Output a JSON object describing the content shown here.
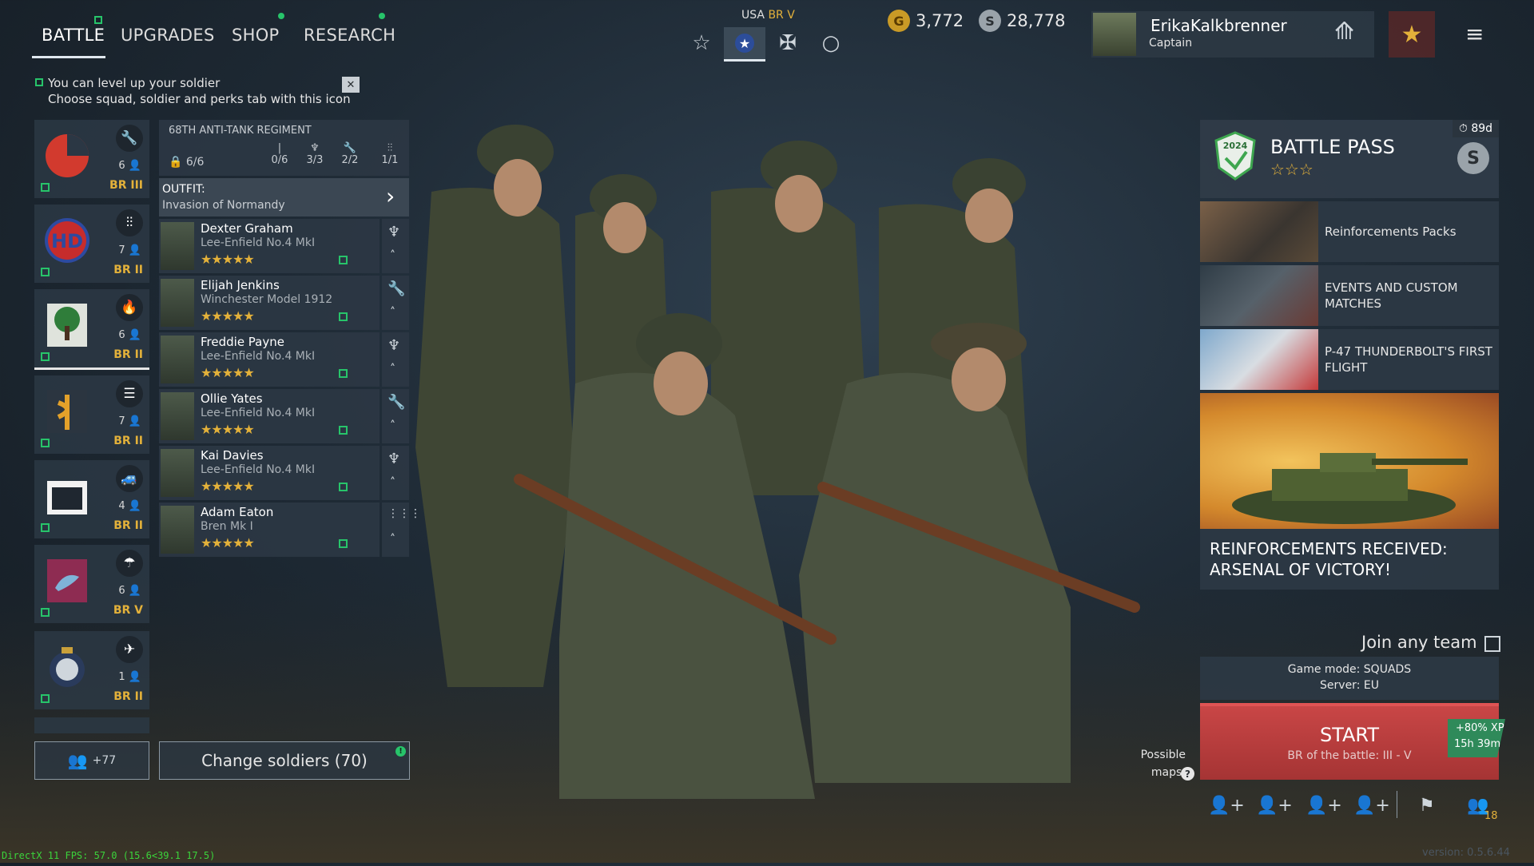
{
  "nav": {
    "tabs": [
      "BATTLE",
      "UPGRADES",
      "SHOP",
      "RESEARCH"
    ]
  },
  "army": {
    "nation": "USA",
    "br": "BR V",
    "selectors": [
      "star-outline-icon",
      "star-badge-icon",
      "cross-icon",
      "circle-icon"
    ]
  },
  "currency": {
    "gold_symbol": "G",
    "gold": "3,772",
    "silver_symbol": "S",
    "silver": "28,778"
  },
  "player": {
    "name": "ErikaKalkbrenner",
    "rank": "Captain"
  },
  "hint": {
    "line1": "You can level up your soldier",
    "line2": "Choose squad, soldier and perks tab with this icon",
    "close": "✕"
  },
  "squads": [
    {
      "icon": "wrench-icon",
      "glyph": "🔧",
      "count": "6",
      "br": "BR III"
    },
    {
      "icon": "rifles-icon",
      "glyph": "⋮⋮",
      "count": "7",
      "br": "BR II"
    },
    {
      "icon": "flame-icon",
      "glyph": "🔥",
      "count": "6",
      "br": "BR II"
    },
    {
      "icon": "list-icon",
      "glyph": "☰",
      "count": "7",
      "br": "BR II"
    },
    {
      "icon": "vehicle-icon",
      "glyph": "🚙",
      "count": "4",
      "br": "BR II"
    },
    {
      "icon": "parachute-icon",
      "glyph": "☂",
      "count": "6",
      "br": "BR V"
    },
    {
      "icon": "planes-icon",
      "glyph": "✈",
      "count": "1",
      "br": "BR II"
    }
  ],
  "regiment": {
    "name": "68TH ANTI-TANK REGIMENT",
    "slots": "6/6",
    "stats": [
      "0/6",
      "3/3",
      "2/2",
      "1/1"
    ],
    "outfit_label": "OUTFIT:",
    "outfit_value": "Invasion of Normandy",
    "soldiers": [
      {
        "name": "Dexter Graham",
        "weapon": "Lee-Enfield No.4 MkI",
        "stars": "★★★★★",
        "class_glyph": "♆"
      },
      {
        "name": "Elijah Jenkins",
        "weapon": "Winchester Model 1912",
        "stars": "★★★★★",
        "class_glyph": "🔧"
      },
      {
        "name": "Freddie Payne",
        "weapon": "Lee-Enfield No.4 MkI",
        "stars": "★★★★★",
        "class_glyph": "♆"
      },
      {
        "name": "Ollie Yates",
        "weapon": "Lee-Enfield No.4 MkI",
        "stars": "★★★★★",
        "class_glyph": "🔧"
      },
      {
        "name": "Kai Davies",
        "weapon": "Lee-Enfield No.4 MkI",
        "stars": "★★★★★",
        "class_glyph": "♆"
      },
      {
        "name": "Adam Eaton",
        "weapon": "Bren Mk I",
        "stars": "★★★★★",
        "class_glyph": "⋮⋮⋮"
      }
    ]
  },
  "bottom_left": {
    "squad_count": "+77",
    "change_soldiers": "Change soldiers (70)"
  },
  "battle_pass": {
    "title": "BATTLE PASS",
    "stars": "☆☆☆",
    "timer": "89d",
    "badge_year": "2024"
  },
  "offers": [
    {
      "label": "Reinforcements Packs"
    },
    {
      "label": "EVENTS AND CUSTOM MATCHES"
    },
    {
      "label": "P-47 THUNDERBOLT'S FIRST FLIGHT"
    }
  ],
  "promo": {
    "title": "REINFORCEMENTS RECEIVED: ARSENAL OF VICTORY!"
  },
  "join": {
    "label": "Join any team"
  },
  "game": {
    "mode": "Game mode: SQUADS",
    "server": "Server: EU"
  },
  "start": {
    "label": "START",
    "br": "BR of the battle: III - V",
    "boost": "+80% XP",
    "boost_time": "15h 39m"
  },
  "maps": {
    "label": "Possible maps:"
  },
  "party": {
    "online": "18"
  },
  "debug": {
    "fps": "DirectX 11 FPS: 57.0 (15.6<39.1 17.5)",
    "version": "version: 0.5.6.44"
  },
  "colors": {
    "accent_green": "#27c46a",
    "br_gold": "#e3b13a",
    "start_red": "#b83c3c"
  }
}
